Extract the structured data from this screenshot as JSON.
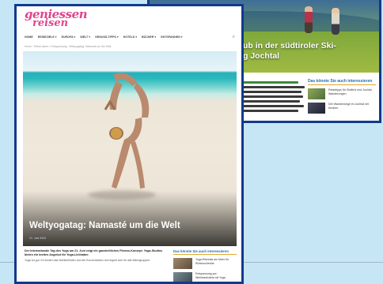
{
  "back_page": {
    "title_line1": "ub in der südtiroler Ski-",
    "title_line2": "g Jochtal",
    "left_column": {
      "heading": "...",
      "lines": [
        "Urlaubsplanung von Lugano aus",
        "ein Ausflug in die Weinberge",
        "des Tessin mit dem Postauto",
        "von Gemeinde zu Gemeinde",
        "mit lokaler Gastronomie",
        "in der Nähe von Mendrisio",
        "beim Wasserfall in der Schlucht"
      ]
    },
    "right_column": {
      "heading": "Das könnte Sie auch interessieren",
      "items": [
        {
          "text": "Reisetipps für Südtirol und Jochtal Wanderungen",
          "thumb_color": "#6b8f4a"
        },
        {
          "text": "Der Wanderwege im Jochtal mit Kindern",
          "thumb_color": "#3a3f52"
        }
      ]
    }
  },
  "front_page": {
    "logo": {
      "line1": "geniessen",
      "line2": "reisen"
    },
    "nav": [
      "HOME",
      "REISEZIELE ▾",
      "EUROPA ▾",
      "WELT ▾",
      "GENUSS-TIPPS ▾",
      "HOTELS ▾",
      "BÜCHER ▾",
      "ENTSPANNEN ▾"
    ],
    "search_icon": "search-icon",
    "breadcrumb": "Home › Reise-Ideen › Entspannung › Weltyogatag: Namasté um die Welt",
    "hero": {
      "title": "Weltyogatag: Namasté um die Welt",
      "date": "21. Juni 2023"
    },
    "intro": {
      "bold": "Der Internationale Tag des Yoga am 21. Juni zeigt ein ganzheitliches Fitness-Konzept. Yoga-Studios bieten ein breites Angebot für Yoga-Liebhaber.",
      "normal": "Yoga tut gut. Es fördert das Wohlbefinden und die Konzentration und eignet sich für alle Altersgruppen."
    },
    "sidebar": {
      "heading": "Das könnte Sie auch interessieren",
      "items": [
        {
          "text": "Yoga-Retreats am Meer für Ruhesuchende",
          "thumb_color": "#7a6a55"
        },
        {
          "text": "Entspannung pur: Wellnesshotels mit Yoga",
          "thumb_color": "#5a6b74"
        }
      ]
    }
  }
}
